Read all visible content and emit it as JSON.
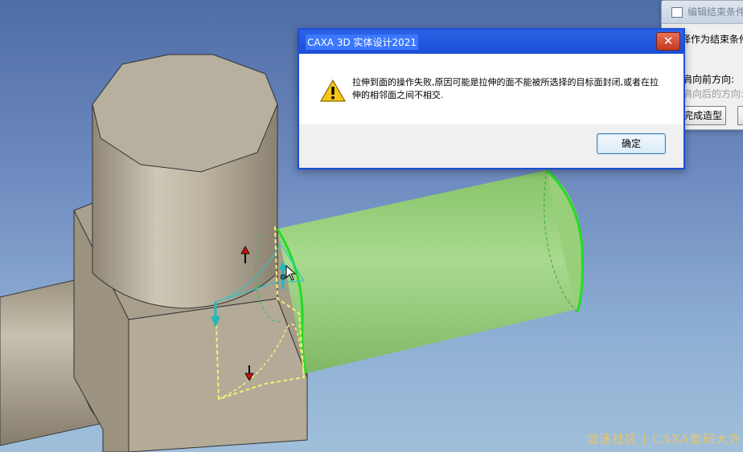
{
  "back_dialog": {
    "title": "编辑结束条件",
    "line1": "择作为结束条件",
    "line2": "肩向前方向:",
    "line3": "肩向后的方向:",
    "finish_button": "完成造型"
  },
  "error_dialog": {
    "title": "CAXA 3D 实体设计2021",
    "message": "拉伸到面的操作失败,原因可能是拉伸的面不能被所选择的目标面封闭,或者在拉伸的相邻面之间不相交.",
    "ok_label": "确定",
    "close_glyph": "✕",
    "icon": "warning-icon"
  },
  "watermark": "咖迷社区 | CAXA数码大方",
  "colors": {
    "dialog_border": "#1a4fd6",
    "close_button": "#c5391f",
    "part_body": "#b3aa98",
    "extrude_preview": "#9fd27d",
    "highlight_edge": "#22dd22",
    "selection_profile": "#f5f07a"
  }
}
